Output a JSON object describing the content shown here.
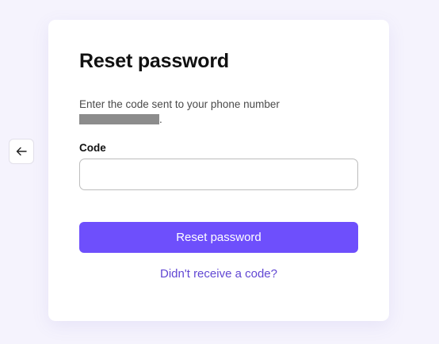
{
  "back_button": {
    "icon": "arrow-left-icon",
    "glyph": "←"
  },
  "reset_form": {
    "title": "Reset password",
    "instructions": "Enter the code sent to your phone number",
    "instructions_suffix": ".",
    "code_label": "Code",
    "code_value": "",
    "code_placeholder": "",
    "submit_label": "Reset password",
    "resend_link": "Didn't receive a code?"
  },
  "colors": {
    "page_background": "#f5f3fd",
    "card_background": "#ffffff",
    "accent": "#6e4ffc",
    "link": "#6147d3",
    "redaction": "#8c8c8c"
  }
}
